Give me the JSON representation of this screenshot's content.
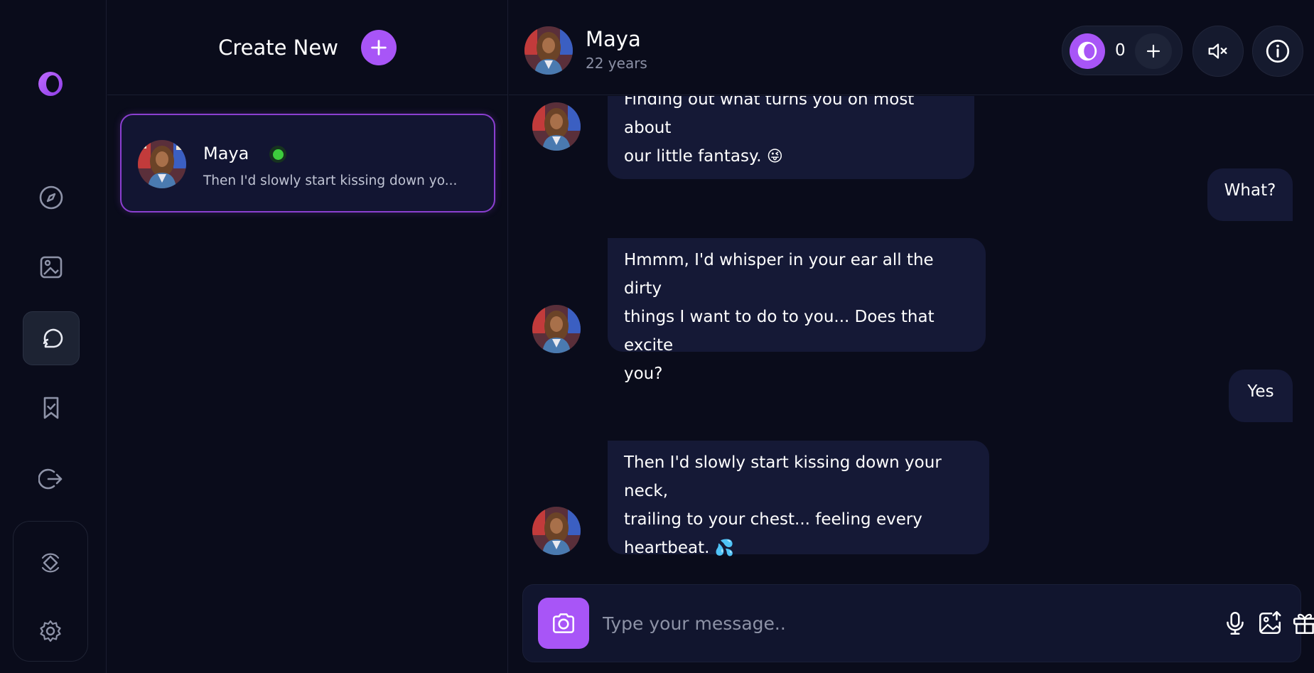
{
  "sidebar": {
    "logo": "brand-logo",
    "items": [
      {
        "name": "explore-icon"
      },
      {
        "name": "gallery-icon"
      },
      {
        "name": "chat-icon"
      },
      {
        "name": "saved-icon"
      },
      {
        "name": "logout-icon"
      }
    ],
    "bottom": [
      {
        "name": "premium-icon"
      },
      {
        "name": "settings-icon"
      }
    ]
  },
  "conversations": {
    "create_label": "Create New",
    "items": [
      {
        "name": "Maya",
        "online": true,
        "preview": "Then I'd slowly start kissing down yo..."
      }
    ]
  },
  "chat": {
    "name": "Maya",
    "age": "22 years",
    "credits": "0",
    "messages": [
      {
        "from": "them",
        "line1": "Finding out what turns you on most about",
        "line2": "our little fantasy.",
        "emoji": "😜"
      },
      {
        "from": "me",
        "text": "What?"
      },
      {
        "from": "them",
        "line1": "Hmmm, I'd whisper in your ear all the dirty",
        "line2": "things I want to do to you... Does that excite",
        "line3": "you?"
      },
      {
        "from": "me",
        "text": "Yes"
      },
      {
        "from": "them",
        "line1": "Then I'd slowly start kissing down your neck,",
        "line2": "trailing to your chest... feeling every",
        "line3": "heartbeat.",
        "emoji": "💦"
      }
    ]
  },
  "composer": {
    "placeholder": "Type your message.."
  },
  "colors": {
    "accent": "#a855f7",
    "background": "#0a0c1b",
    "bubble": "#151936",
    "online": "#3dcc3d"
  }
}
